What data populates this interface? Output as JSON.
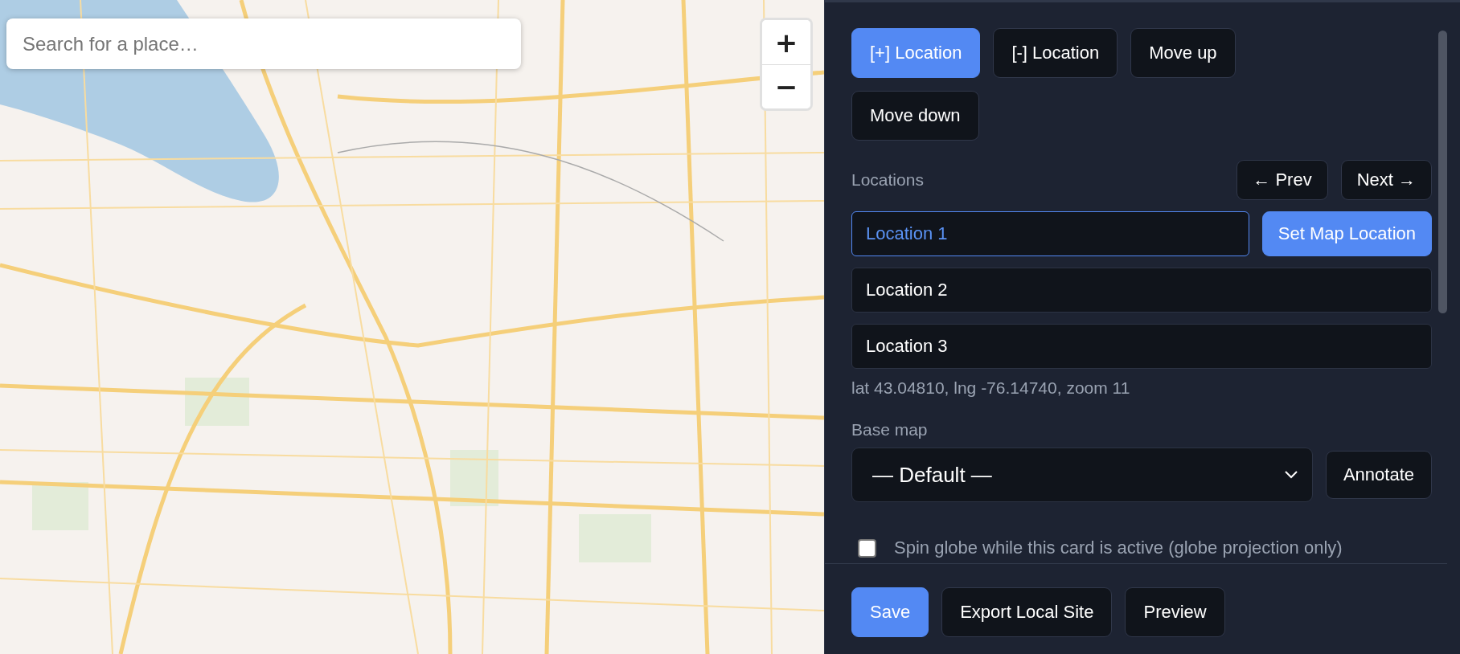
{
  "map": {
    "search": {
      "placeholder": "Search for a place…"
    },
    "zoom_controls": [
      "+",
      "−"
    ]
  },
  "panel": {
    "action_buttons": [
      {
        "label": "[+] Location",
        "primary": true
      },
      {
        "label": "[-] Location",
        "primary": false
      },
      {
        "label": "Move up",
        "primary": false
      },
      {
        "label": "Move down",
        "primary": false
      }
    ],
    "locations_label": "Locations",
    "nav_buttons": [
      "← Prev",
      "Next →"
    ],
    "locations": [
      {
        "value": "Location 1",
        "selected": true
      },
      {
        "value": "Location 2",
        "selected": false
      },
      {
        "value": "Location 3",
        "selected": false
      }
    ],
    "set_location_button": "Set Map Location",
    "coordinates": "lat 43.04810, lng -76.14740, zoom 11",
    "base_map": {
      "label": "Base map",
      "value": "— Default —"
    },
    "annotate_button": "Annotate",
    "spin_globe": {
      "label": "Spin globe while this card is active (globe projection only)",
      "checked": false
    },
    "footer_buttons": [
      {
        "label": "Save",
        "primary": true
      },
      {
        "label": "Export Local Site",
        "primary": false
      },
      {
        "label": "Preview",
        "primary": false
      }
    ]
  }
}
